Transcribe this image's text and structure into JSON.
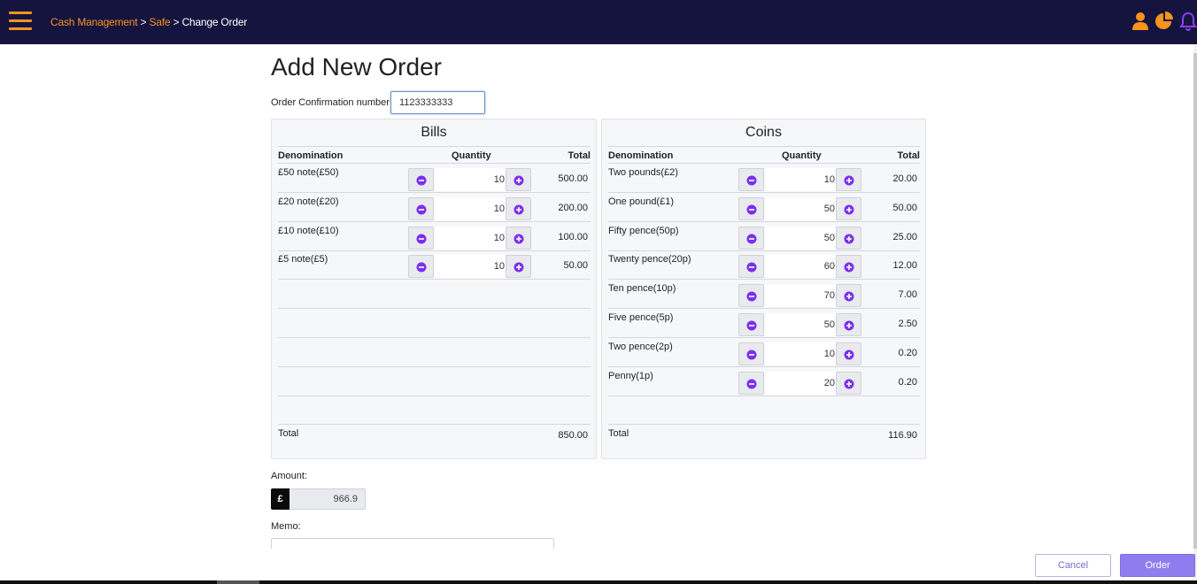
{
  "header": {
    "breadcrumb": [
      {
        "label": "Cash Management",
        "link": true
      },
      {
        "label": "Safe",
        "link": true
      },
      {
        "label": "Change Order",
        "link": false
      }
    ],
    "separator": " > ",
    "icons": [
      "user-icon",
      "pie-chart-icon",
      "bell-icon"
    ],
    "colors": {
      "bar": "#15143f",
      "accent": "#f7941d",
      "bell": "#8a3ff0"
    }
  },
  "page": {
    "title": "Add New Order",
    "confirmation_label": "Order Confirmation number",
    "confirmation_value": "1123333333"
  },
  "bills": {
    "title": "Bills",
    "col_denomination": "Denomination",
    "col_quantity": "Quantity",
    "col_total": "Total",
    "rows": [
      {
        "denomination": "£50 note(£50)",
        "quantity": "10",
        "total": "500.00"
      },
      {
        "denomination": "£20 note(£20)",
        "quantity": "10",
        "total": "200.00"
      },
      {
        "denomination": "£10 note(£10)",
        "quantity": "10",
        "total": "100.00"
      },
      {
        "denomination": "£5 note(£5)",
        "quantity": "10",
        "total": "50.00"
      }
    ],
    "total_label": "Total",
    "total_value": "850.00"
  },
  "coins": {
    "title": "Coins",
    "col_denomination": "Denomination",
    "col_quantity": "Quantity",
    "col_total": "Total",
    "rows": [
      {
        "denomination": "Two pounds(£2)",
        "quantity": "10",
        "total": "20.00"
      },
      {
        "denomination": "One pound(£1)",
        "quantity": "50",
        "total": "50.00"
      },
      {
        "denomination": "Fifty pence(50p)",
        "quantity": "50",
        "total": "25.00"
      },
      {
        "denomination": "Twenty pence(20p)",
        "quantity": "60",
        "total": "12.00"
      },
      {
        "denomination": "Ten pence(10p)",
        "quantity": "70",
        "total": "7.00"
      },
      {
        "denomination": "Five pence(5p)",
        "quantity": "50",
        "total": "2.50"
      },
      {
        "denomination": "Two pence(2p)",
        "quantity": "10",
        "total": "0.20"
      },
      {
        "denomination": "Penny(1p)",
        "quantity": "20",
        "total": "0.20"
      }
    ],
    "total_label": "Total",
    "total_value": "116.90"
  },
  "amount": {
    "label": "Amount:",
    "currency_symbol": "£",
    "value": "966.9"
  },
  "memo": {
    "label": "Memo:",
    "value": ""
  },
  "actions": {
    "cancel_label": "Cancel",
    "order_label": "Order"
  }
}
